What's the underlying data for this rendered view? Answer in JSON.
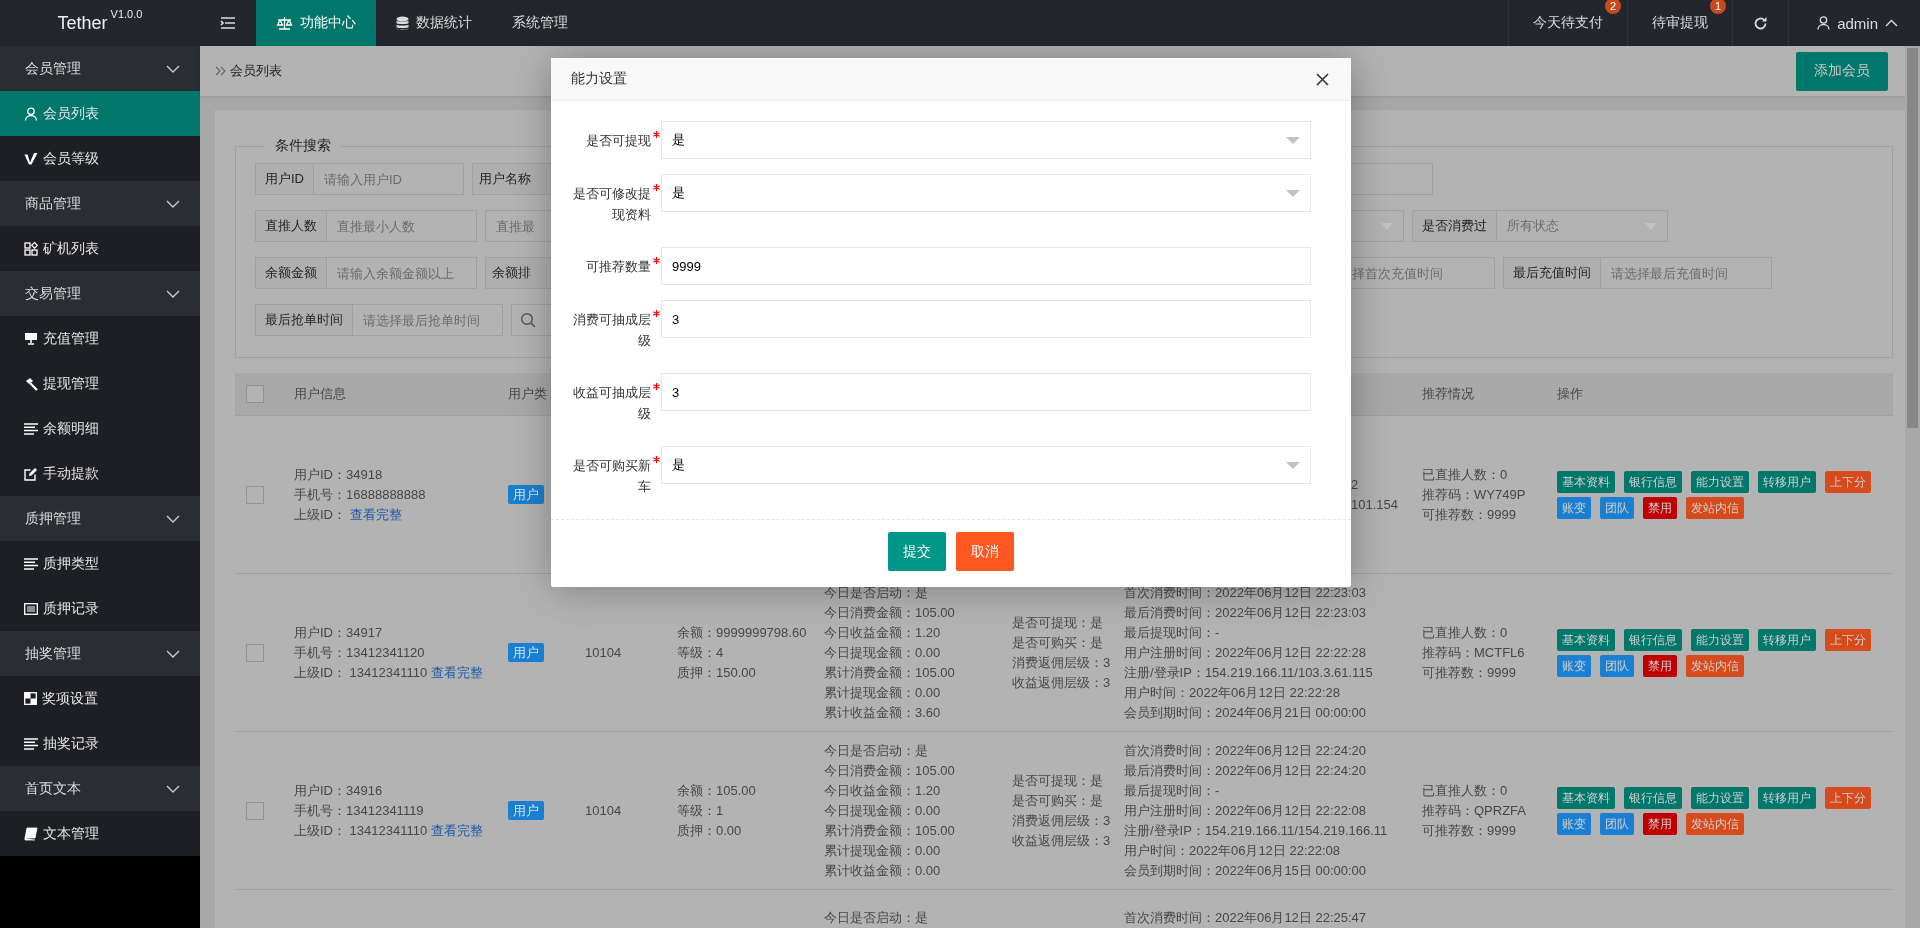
{
  "header": {
    "logo": "Tether",
    "version": "V1.0.0",
    "tabs": [
      {
        "label": "功能中心",
        "selected": true
      },
      {
        "label": "数据统计",
        "selected": false
      },
      {
        "label": "系统管理",
        "selected": false
      }
    ],
    "notices": [
      {
        "label": "今天待支付",
        "badge": "2"
      },
      {
        "label": "待审提现",
        "badge": "1"
      }
    ],
    "user": "admin"
  },
  "sidebar": {
    "groups": [
      {
        "label": "会员管理",
        "expanded": true,
        "children": [
          {
            "label": "会员列表",
            "selected": true
          },
          {
            "label": "会员等级",
            "selected": false
          }
        ]
      },
      {
        "label": "商品管理",
        "expanded": true,
        "children": [
          {
            "label": "矿机列表",
            "selected": false
          }
        ]
      },
      {
        "label": "交易管理",
        "expanded": true,
        "children": [
          {
            "label": "充值管理",
            "selected": false
          },
          {
            "label": "提现管理",
            "selected": false
          },
          {
            "label": "余额明细",
            "selected": false
          },
          {
            "label": "手动提款",
            "selected": false
          }
        ]
      },
      {
        "label": "质押管理",
        "expanded": true,
        "children": [
          {
            "label": "质押类型",
            "selected": false
          },
          {
            "label": "质押记录",
            "selected": false
          }
        ]
      },
      {
        "label": "抽奖管理",
        "expanded": true,
        "children": [
          {
            "label": "奖项设置",
            "selected": false
          },
          {
            "label": "抽奖记录",
            "selected": false
          }
        ]
      },
      {
        "label": "首页文本",
        "expanded": true,
        "children": [
          {
            "label": "文本管理",
            "selected": false
          }
        ]
      }
    ]
  },
  "breadcrumb": "会员列表",
  "add_button": "添加会员",
  "search": {
    "title": "条件搜索",
    "rows": [
      {
        "left": [
          {
            "kind": "labeled-input",
            "label": "用户ID",
            "placeholder": "请输入用户ID"
          },
          {
            "kind": "label",
            "label": "用户名称"
          }
        ],
        "right": [
          {
            "kind": "input"
          }
        ]
      },
      {
        "left": [
          {
            "kind": "labeled-input",
            "label": "直推人数",
            "placeholder": "直推最小人数"
          },
          {
            "kind": "input",
            "placeholder": "直推最"
          }
        ],
        "right": [
          {
            "kind": "select"
          },
          {
            "kind": "labeled-select",
            "label": "是否消费过",
            "placeholder": "所有状态"
          }
        ]
      },
      {
        "left": [
          {
            "kind": "labeled-input",
            "label": "余额金额",
            "placeholder": "请输入余额金额以上"
          },
          {
            "kind": "label",
            "label": "余额排"
          }
        ],
        "right": [
          {
            "kind": "input",
            "placeholder": "择首次充值时间"
          },
          {
            "kind": "labeled-input",
            "label": "最后充值时间",
            "placeholder": "请选择最后充值时间"
          }
        ]
      },
      {
        "left": [
          {
            "kind": "labeled-input",
            "label": "最后抢单时间",
            "placeholder": "请选择最后抢单时间"
          },
          {
            "kind": "search-button"
          }
        ],
        "right": []
      }
    ]
  },
  "table": {
    "header": {
      "checked": false,
      "user_info": "用户信息",
      "user_type": "用户类",
      "recommend": "推荐情况",
      "actions": "操作"
    },
    "rows": [
      {
        "checked": false,
        "user_info": [
          "用户ID：34918",
          "手机号：16888888888"
        ],
        "parent": "上级ID：",
        "link": "查看完整",
        "type": "用户",
        "time": [
          "2",
          "101.154"
        ],
        "recommend": [
          "已直推人数：0",
          "推荐码：WY749P",
          "可推荐数：9999"
        ],
        "actions": [
          {
            "label": "基本资料",
            "color": "#00776a"
          },
          {
            "label": "银行信息",
            "color": "#00776a"
          },
          {
            "label": "能力设置",
            "color": "#00776a"
          },
          {
            "label": "转移用户",
            "color": "#00776a"
          },
          {
            "label": "上下分",
            "color": "#d64a1c"
          },
          {
            "label": "账变",
            "color": "#1a7fd0"
          },
          {
            "label": "团队",
            "color": "#1a7fd0"
          },
          {
            "label": "禁用",
            "color": "#c00000"
          },
          {
            "label": "发站内信",
            "color": "#d64a1c"
          }
        ]
      },
      {
        "checked": false,
        "user_info": [
          "用户ID：34917",
          "手机号：13412341120"
        ],
        "parent": "上级ID： 13412341110",
        "link": "查看完整",
        "type": "用户",
        "code": "10104",
        "balance": [
          "余额：9999999798.60",
          "等级：4",
          "质押：150.00"
        ],
        "stats": [
          "今日是否启动：是",
          "今日消费金额：105.00",
          "今日收益金额：1.20",
          "今日提现金额：0.00",
          "累计消费金额：105.00",
          "累计提现金额：0.00",
          "累计收益金额：3.60"
        ],
        "flags": [
          "是否可提现：是",
          "是否可购买：是",
          "消费返佣层级：3",
          "收益返佣层级：3"
        ],
        "time": [
          "首次消费时间：2022年06月12日 22:23:03",
          "最后消费时间：2022年06月12日 22:23:03",
          "最后提现时间：-",
          "用户注册时间：2022年06月12日 22:22:28",
          "注册/登录IP：154.219.166.11/103.3.61.115",
          "用户时间：2022年06月12日 22:22:28",
          "会员到期时间：2024年06月21日 00:00:00"
        ],
        "recommend": [
          "已直推人数：0",
          "推荐码：MCTFL6",
          "可推荐数：9999"
        ],
        "actions": [
          {
            "label": "基本资料",
            "color": "#00776a"
          },
          {
            "label": "银行信息",
            "color": "#00776a"
          },
          {
            "label": "能力设置",
            "color": "#00776a"
          },
          {
            "label": "转移用户",
            "color": "#00776a"
          },
          {
            "label": "上下分",
            "color": "#d64a1c"
          },
          {
            "label": "账变",
            "color": "#1a7fd0"
          },
          {
            "label": "团队",
            "color": "#1a7fd0"
          },
          {
            "label": "禁用",
            "color": "#c00000"
          },
          {
            "label": "发站内信",
            "color": "#d64a1c"
          }
        ]
      },
      {
        "checked": false,
        "user_info": [
          "用户ID：34916",
          "手机号：13412341119"
        ],
        "parent": "上级ID： 13412341110",
        "link": "查看完整",
        "type": "用户",
        "code": "10104",
        "balance": [
          "余额：105.00",
          "等级：1",
          "质押：0.00"
        ],
        "stats": [
          "今日是否启动：是",
          "今日消费金额：105.00",
          "今日收益金额：1.20",
          "今日提现金额：0.00",
          "累计消费金额：105.00",
          "累计提现金额：0.00",
          "累计收益金额：0.00"
        ],
        "flags": [
          "是否可提现：是",
          "是否可购买：是",
          "消费返佣层级：3",
          "收益返佣层级：3"
        ],
        "time": [
          "首次消费时间：2022年06月12日 22:24:20",
          "最后消费时间：2022年06月12日 22:24:20",
          "最后提现时间：-",
          "用户注册时间：2022年06月12日 22:22:08",
          "注册/登录IP：154.219.166.11/154.219.166.11",
          "用户时间：2022年06月12日 22:22:08",
          "会员到期时间：2022年06月15日 00:00:00"
        ],
        "recommend": [
          "已直推人数：0",
          "推荐码：QPRZFA",
          "可推荐数：9999"
        ],
        "actions": [
          {
            "label": "基本资料",
            "color": "#00776a"
          },
          {
            "label": "银行信息",
            "color": "#00776a"
          },
          {
            "label": "能力设置",
            "color": "#00776a"
          },
          {
            "label": "转移用户",
            "color": "#00776a"
          },
          {
            "label": "上下分",
            "color": "#d64a1c"
          },
          {
            "label": "账变",
            "color": "#1a7fd0"
          },
          {
            "label": "团队",
            "color": "#1a7fd0"
          },
          {
            "label": "禁用",
            "color": "#c00000"
          },
          {
            "label": "发站内信",
            "color": "#d64a1c"
          }
        ]
      },
      {
        "stats": [
          "今日是否启动：是"
        ],
        "time": [
          "首次消费时间：2022年06月12日 22:25:47"
        ]
      }
    ]
  },
  "modal": {
    "title": "能力设置",
    "fields": [
      {
        "label": "是否可提现",
        "required": true,
        "kind": "select",
        "value": "是"
      },
      {
        "label": "是否可修改提现资料",
        "required": true,
        "kind": "select",
        "value": "是"
      },
      {
        "label": "可推荐数量",
        "required": true,
        "kind": "input",
        "value": "9999"
      },
      {
        "label": "消费可抽成层级",
        "required": true,
        "kind": "input",
        "value": "3"
      },
      {
        "label": "收益可抽成层级",
        "required": true,
        "kind": "input",
        "value": "3"
      },
      {
        "label": "是否可购买新车",
        "required": true,
        "kind": "select",
        "value": "是"
      }
    ],
    "submit": "提交",
    "cancel": "取消"
  }
}
